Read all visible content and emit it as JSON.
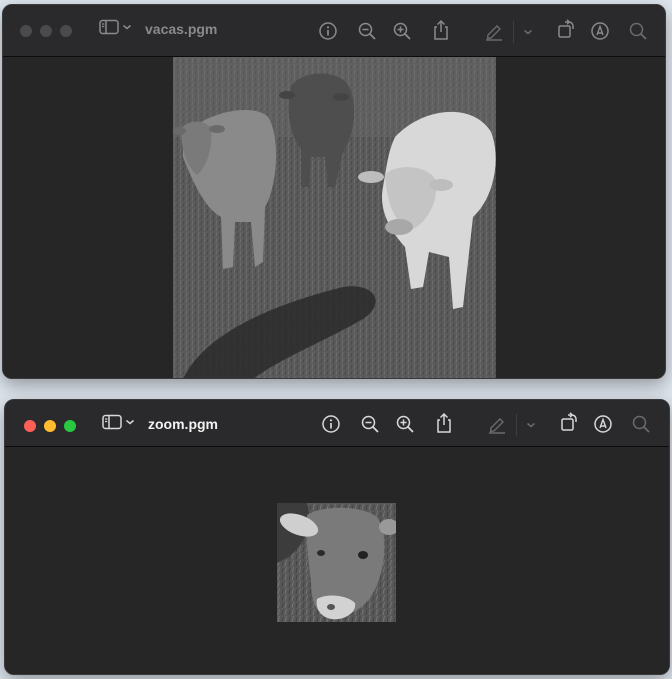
{
  "windows": [
    {
      "title": "vacas.pgm",
      "state": "inactive",
      "image_description": "grayscale photo of three cows standing in a grassy field, long shadows in foreground"
    },
    {
      "title": "zoom.pgm",
      "state": "active",
      "image_description": "grayscale zoomed crop of a cow's head"
    }
  ],
  "toolbar_icons": [
    "sidebar-icon",
    "chevron-down-icon",
    "info-icon",
    "zoom-out-icon",
    "zoom-in-icon",
    "share-icon",
    "markup-pen-icon",
    "chevron-down-icon",
    "rotate-icon",
    "annotate-icon",
    "search-icon"
  ],
  "colors": {
    "window_bg": "#262626",
    "titlebar_bg": "#2a2a2c",
    "icon_active": "#d8d8d8",
    "icon_inactive": "#8a8a8d",
    "close": "#fe5f57",
    "minimize": "#febc2e",
    "maximize": "#28c840"
  }
}
